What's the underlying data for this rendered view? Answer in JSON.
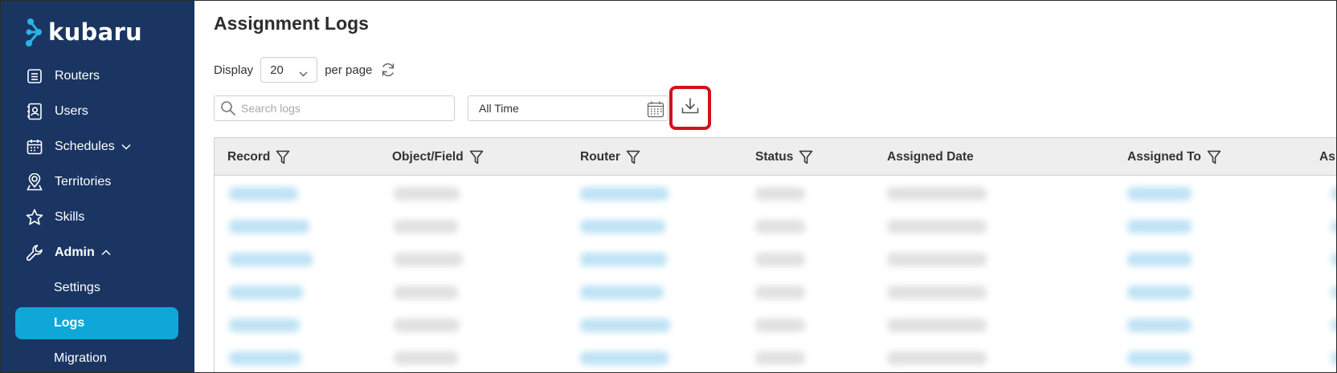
{
  "app": {
    "brand": "kubaru"
  },
  "sidebar": {
    "items": [
      {
        "label": "Routers",
        "icon": "list-icon"
      },
      {
        "label": "Users",
        "icon": "contacts-book-icon"
      },
      {
        "label": "Schedules",
        "icon": "calendar-icon",
        "expandable": true
      },
      {
        "label": "Territories",
        "icon": "map-pin-person-icon"
      },
      {
        "label": "Skills",
        "icon": "star-icon"
      },
      {
        "label": "Admin",
        "icon": "wrench-icon",
        "expanded": true
      }
    ],
    "admin_subitems": [
      {
        "label": "Settings",
        "active": false
      },
      {
        "label": "Logs",
        "active": true
      },
      {
        "label": "Migration",
        "active": false
      }
    ]
  },
  "main": {
    "title": "Assignment Logs",
    "display_label": "Display",
    "per_page_value": "20",
    "per_page_label": "per page",
    "search_placeholder": "Search logs",
    "date_range_value": "All Time",
    "table": {
      "columns": [
        {
          "label": "Record",
          "filter": true
        },
        {
          "label": "Object/Field",
          "filter": true
        },
        {
          "label": "Router",
          "filter": true
        },
        {
          "label": "Status",
          "filter": true
        },
        {
          "label": "Assigned Date",
          "filter": false
        },
        {
          "label": "Assigned To",
          "filter": true
        },
        {
          "label": "As",
          "filter": false
        }
      ],
      "visible_row_count": 6
    }
  },
  "colors": {
    "sidebar_bg": "#1a3562",
    "active_item_bg": "#0fa6d8",
    "highlight_border": "#d3111b",
    "table_header_bg": "#eeeeee"
  }
}
